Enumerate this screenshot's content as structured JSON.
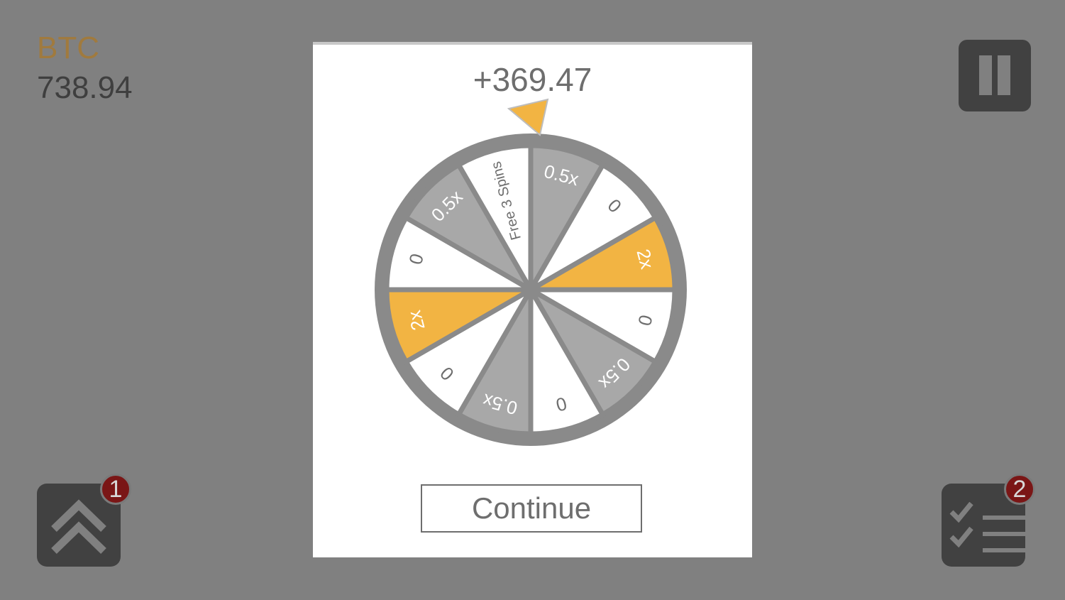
{
  "currency": {
    "name": "BTC",
    "amount": "738.94"
  },
  "reward": {
    "text": "+369.47"
  },
  "wheel": {
    "segments": [
      {
        "label": "0.5x",
        "fill": "#a8a8a8"
      },
      {
        "label": "0",
        "fill": "#ffffff"
      },
      {
        "label": "2x",
        "fill": "#f2b443"
      },
      {
        "label": "0",
        "fill": "#ffffff"
      },
      {
        "label": "0.5x",
        "fill": "#a8a8a8"
      },
      {
        "label": "0",
        "fill": "#ffffff"
      },
      {
        "label": "0.5x",
        "fill": "#a8a8a8"
      },
      {
        "label": "0",
        "fill": "#ffffff"
      },
      {
        "label": "2x",
        "fill": "#f2b443"
      },
      {
        "label": "0",
        "fill": "#ffffff"
      },
      {
        "label": "0.5x",
        "fill": "#a8a8a8"
      },
      {
        "label": "Free 3 Spins",
        "fill": "#ffffff"
      }
    ]
  },
  "continue_button": {
    "label": "Continue"
  },
  "upgrade_button": {
    "badge": "1"
  },
  "tasks_button": {
    "badge": "2"
  },
  "colors": {
    "accent": "#f2b443",
    "badge": "#7a1616",
    "background": "#808080"
  }
}
